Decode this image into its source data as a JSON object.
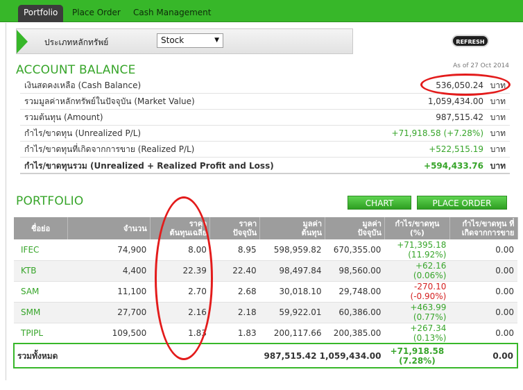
{
  "nav": {
    "tabs": [
      {
        "label": "Portfolio",
        "active": true
      },
      {
        "label": "Place Order",
        "active": false
      },
      {
        "label": "Cash Management",
        "active": false
      }
    ]
  },
  "filter": {
    "label": "ประเภทหลักทรัพย์",
    "selected": "Stock",
    "refresh_label": "REFRESH"
  },
  "account": {
    "title": "ACCOUNT BALANCE",
    "as_of": "As of 27 Oct 2014",
    "rows": [
      {
        "label": "เงินสดคงเหลือ (Cash Balance)",
        "value": "536,050.24",
        "unit": "บาท",
        "tone": ""
      },
      {
        "label": "รวมมูลค่าหลักทรัพย์ในปัจจุบัน (Market Value)",
        "value": "1,059,434.00",
        "unit": "บาท",
        "tone": ""
      },
      {
        "label": "รวมต้นทุน (Amount)",
        "value": "987,515.42",
        "unit": "บาท",
        "tone": ""
      },
      {
        "label": "กำไร/ขาดทุน (Unrealized P/L)",
        "value": "+71,918.58 (+7.28%)",
        "unit": "บาท",
        "tone": "pos"
      },
      {
        "label": "กำไร/ขาดทุนที่เกิดจากการขาย (Realized P/L)",
        "value": "+522,515.19",
        "unit": "บาท",
        "tone": "pos"
      }
    ],
    "total": {
      "label": "กำไร/ขาดทุนรวม (Unrealized + Realized Profit and Loss)",
      "value": "+594,433.76",
      "unit": "บาท"
    }
  },
  "portfolio": {
    "title": "PORTFOLIO",
    "chart_button": "CHART",
    "order_button": "PLACE ORDER",
    "headers": [
      [
        "ชื่อย่อ"
      ],
      [
        "จำนวน"
      ],
      [
        "ราคา",
        "ต้นทุนเฉลี่ย"
      ],
      [
        "ราคา",
        "ปัจจุบัน"
      ],
      [
        "มูลค่า",
        "ต้นทุน"
      ],
      [
        "มูลค่า",
        "ปัจจุบัน"
      ],
      [
        "กำไร/ขาดทุน (%)"
      ],
      [
        "กำไร/ขาดทุน ที่",
        "เกิดจากการขาย"
      ]
    ],
    "rows": [
      {
        "symbol": "IFEC",
        "qty": "74,900",
        "avg": "8.00",
        "last": "8.95",
        "cost": "598,959.82",
        "mkt": "670,355.00",
        "pl": "+71,395.18",
        "pct": "(11.92%)",
        "tone": "pos",
        "realized": "0.00"
      },
      {
        "symbol": "KTB",
        "qty": "4,400",
        "avg": "22.39",
        "last": "22.40",
        "cost": "98,497.84",
        "mkt": "98,560.00",
        "pl": "+62.16",
        "pct": "(0.06%)",
        "tone": "pos",
        "realized": "0.00"
      },
      {
        "symbol": "SAM",
        "qty": "11,100",
        "avg": "2.70",
        "last": "2.68",
        "cost": "30,018.10",
        "mkt": "29,748.00",
        "pl": "-270.10",
        "pct": "(-0.90%)",
        "tone": "neg",
        "realized": "0.00"
      },
      {
        "symbol": "SMM",
        "qty": "27,700",
        "avg": "2.16",
        "last": "2.18",
        "cost": "59,922.01",
        "mkt": "60,386.00",
        "pl": "+463.99",
        "pct": "(0.77%)",
        "tone": "pos",
        "realized": "0.00"
      },
      {
        "symbol": "TPIPL",
        "qty": "109,500",
        "avg": "1.83",
        "last": "1.83",
        "cost": "200,117.66",
        "mkt": "200,385.00",
        "pl": "+267.34",
        "pct": "(0.13%)",
        "tone": "pos",
        "realized": "0.00"
      }
    ],
    "summary": {
      "label": "รวมทั้งหมด",
      "cost_mkt": "987,515.42 1,059,434.00",
      "pl": "+71,918.58",
      "pct": "(7.28%)",
      "realized": "0.00"
    }
  },
  "colors": {
    "accent": "#37b729",
    "highlight": "#e31b1b"
  }
}
